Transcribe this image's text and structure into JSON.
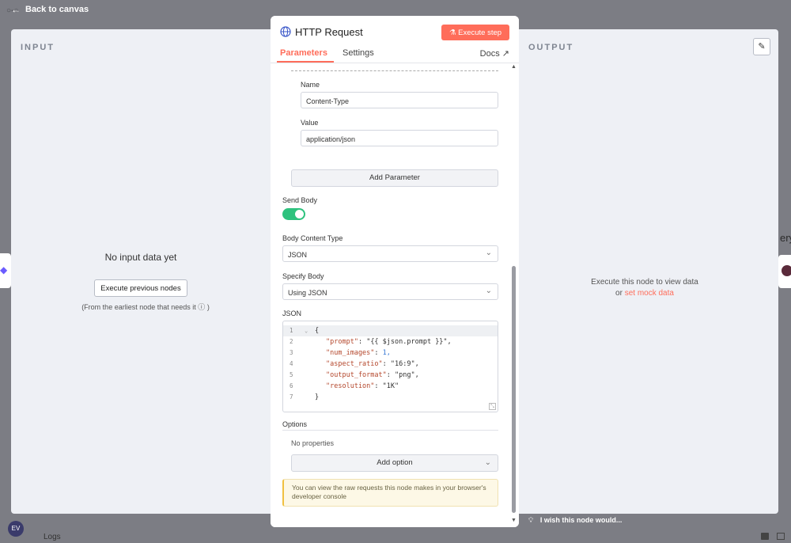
{
  "topbar": {
    "back_label": "Back to canvas"
  },
  "input_panel": {
    "title": "INPUT",
    "empty_title": "No input data yet",
    "execute_previous_label": "Execute previous nodes",
    "hint": "(From the earliest node that needs it",
    "hint_suffix": ")"
  },
  "output_panel": {
    "title": "OUTPUT",
    "message_line1": "Execute this node to view data",
    "message_or": "or",
    "mock_link": "set mock data"
  },
  "background": {
    "partial_text": "ery"
  },
  "node": {
    "title": "HTTP Request",
    "execute_step_label": "Execute step",
    "tabs": [
      {
        "label": "Parameters",
        "active": true
      },
      {
        "label": "Settings",
        "active": false
      }
    ],
    "docs_label": "Docs"
  },
  "header_param": {
    "name_label": "Name",
    "name_value": "Content-Type",
    "value_label": "Value",
    "value_value": "application/json",
    "add_parameter_label": "Add Parameter"
  },
  "send_body": {
    "label": "Send Body",
    "enabled": true
  },
  "body_content_type": {
    "label": "Body Content Type",
    "value": "JSON"
  },
  "specify_body": {
    "label": "Specify Body",
    "value": "Using JSON"
  },
  "json_editor": {
    "label": "JSON",
    "lines": [
      {
        "n": "1",
        "text": "{"
      },
      {
        "n": "2",
        "key": "\"prompt\"",
        "val": " \"{{ $json.prompt }}\","
      },
      {
        "n": "3",
        "key": "\"num_images\"",
        "val": " 1,"
      },
      {
        "n": "4",
        "key": "\"aspect_ratio\"",
        "val": " \"16:9\","
      },
      {
        "n": "5",
        "key": "\"output_format\"",
        "val": " \"png\","
      },
      {
        "n": "6",
        "key": "\"resolution\"",
        "val": " \"1K\""
      },
      {
        "n": "7",
        "text": "}"
      }
    ]
  },
  "options": {
    "label": "Options",
    "empty": "No properties",
    "add_option_label": "Add option"
  },
  "notice": {
    "text": "You can view the raw requests this node makes in your browser's developer console"
  },
  "footer": {
    "avatar_initials": "EV",
    "logs_label": "Logs",
    "wish_label": "I wish this node would..."
  },
  "colors": {
    "accent": "#ff6d5a",
    "toggle_on": "#2ec27e",
    "backdrop": "#7c7d84"
  }
}
